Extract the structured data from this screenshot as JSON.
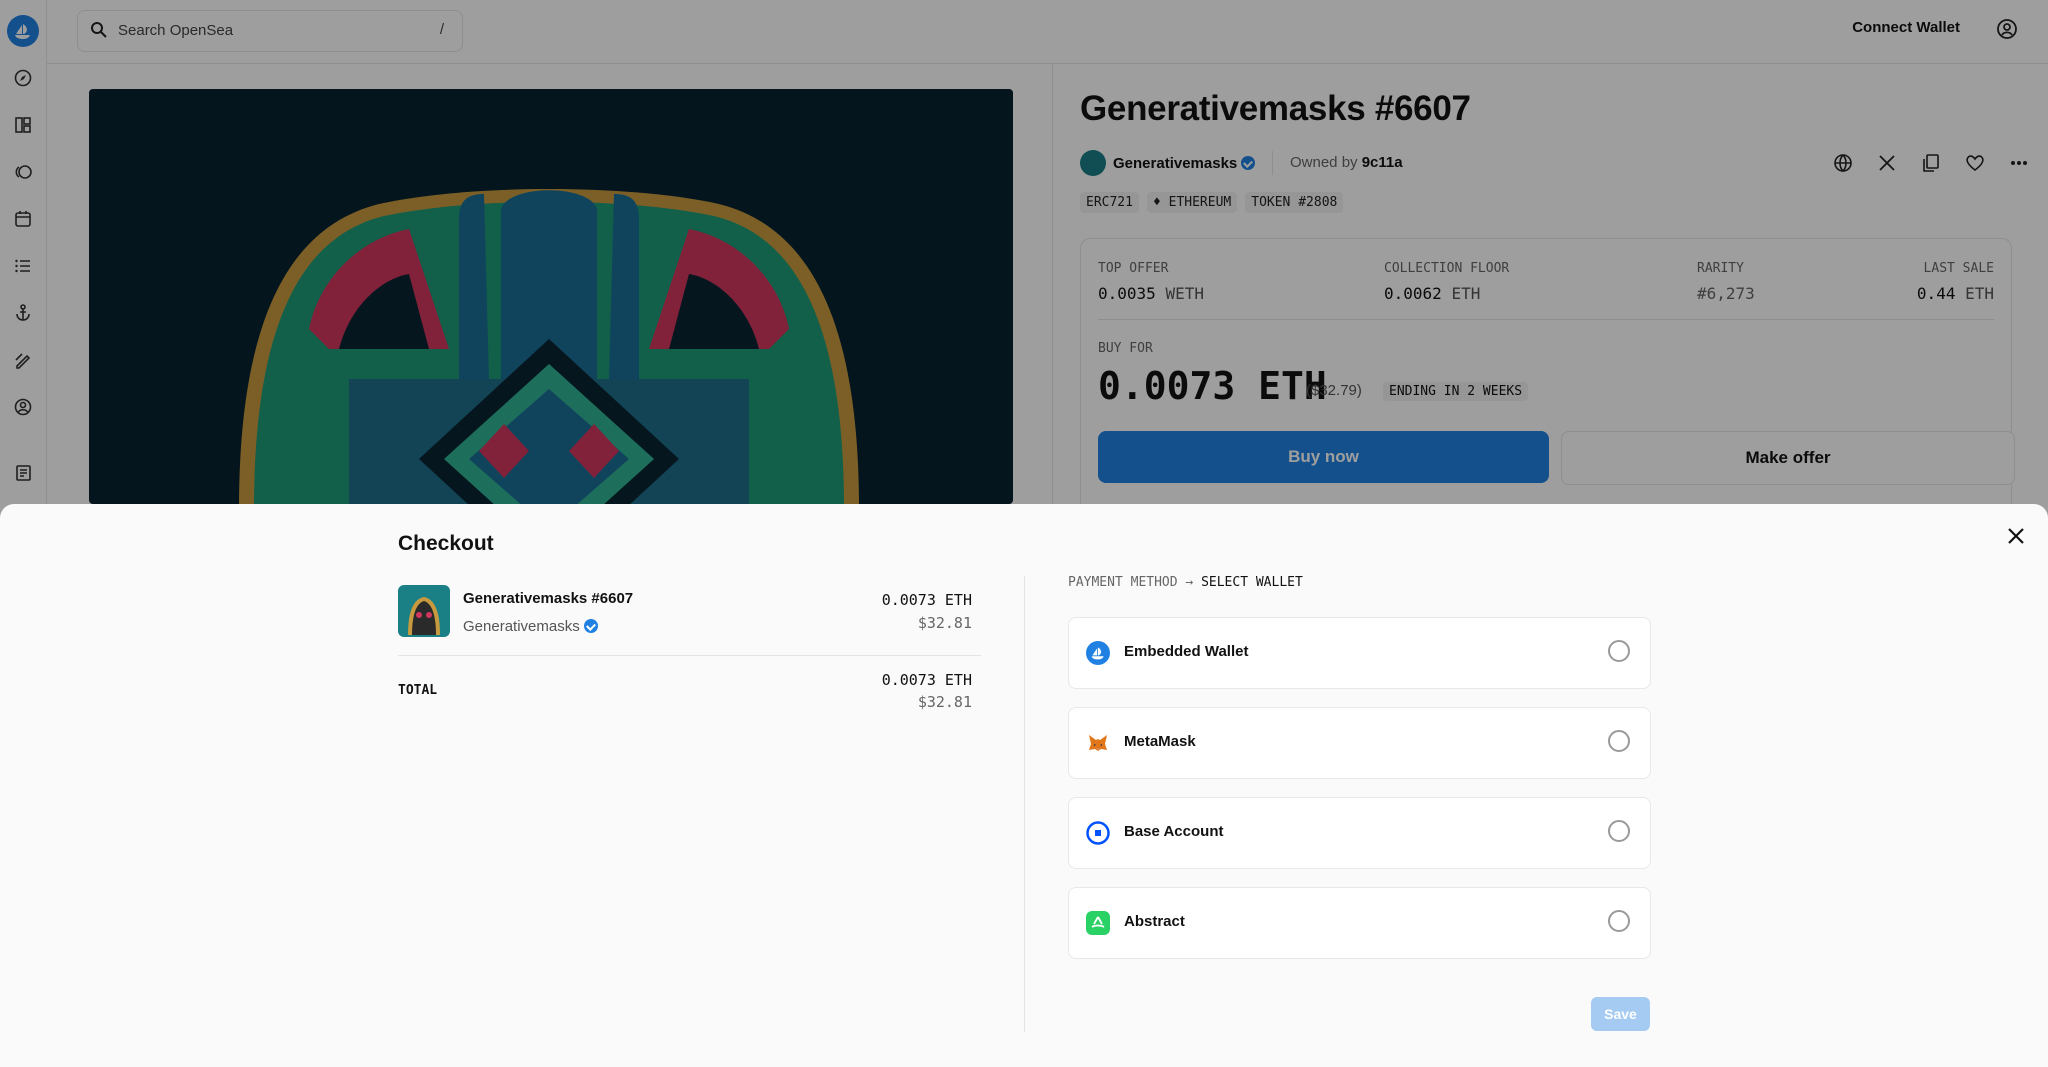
{
  "search": {
    "placeholder": "Search OpenSea",
    "shortcut": "/"
  },
  "topbar": {
    "connect_label": "Connect Wallet"
  },
  "nft": {
    "title": "Generativemasks #6607",
    "collection": "Generativemasks",
    "owned_by_label": "Owned by",
    "owner": "9c11a",
    "tags": [
      "ERC721",
      "ETHEREUM",
      "TOKEN #2808"
    ],
    "stats": [
      {
        "label": "TOP OFFER",
        "value": "0.0035",
        "unit": "WETH"
      },
      {
        "label": "COLLECTION FLOOR",
        "value": "0.0062",
        "unit": "ETH"
      },
      {
        "label": "RARITY",
        "value": "#6,273",
        "unit": ""
      },
      {
        "label": "LAST SALE",
        "value": "0.44",
        "unit": "ETH"
      }
    ],
    "buy_for_label": "BUY FOR",
    "price": "0.0073 ETH",
    "price_usd": "($32.79)",
    "ending": "ENDING IN 2 WEEKS",
    "buy_label": "Buy now",
    "offer_label": "Make offer"
  },
  "checkout": {
    "title": "Checkout",
    "item_name": "Generativemasks #6607",
    "item_collection": "Generativemasks",
    "item_eth": "0.0073 ETH",
    "item_usd": "$32.81",
    "total_label": "TOTAL",
    "total_eth": "0.0073 ETH",
    "total_usd": "$32.81",
    "breadcrumb_step1": "PAYMENT METHOD",
    "breadcrumb_arrow": "→",
    "breadcrumb_step2": "SELECT WALLET",
    "wallets": [
      {
        "name": "Embedded Wallet",
        "icon": "opensea-icon",
        "color": "#2081e2"
      },
      {
        "name": "MetaMask",
        "icon": "metamask-fox-icon",
        "color": "#e2761b"
      },
      {
        "name": "Base Account",
        "icon": "base-icon",
        "color": "#0052ff"
      },
      {
        "name": "Abstract",
        "icon": "abstract-icon",
        "color": "#2ad265"
      }
    ],
    "save_label": "Save"
  },
  "colors": {
    "accent": "#2081e2",
    "art_bg": "#082230"
  }
}
